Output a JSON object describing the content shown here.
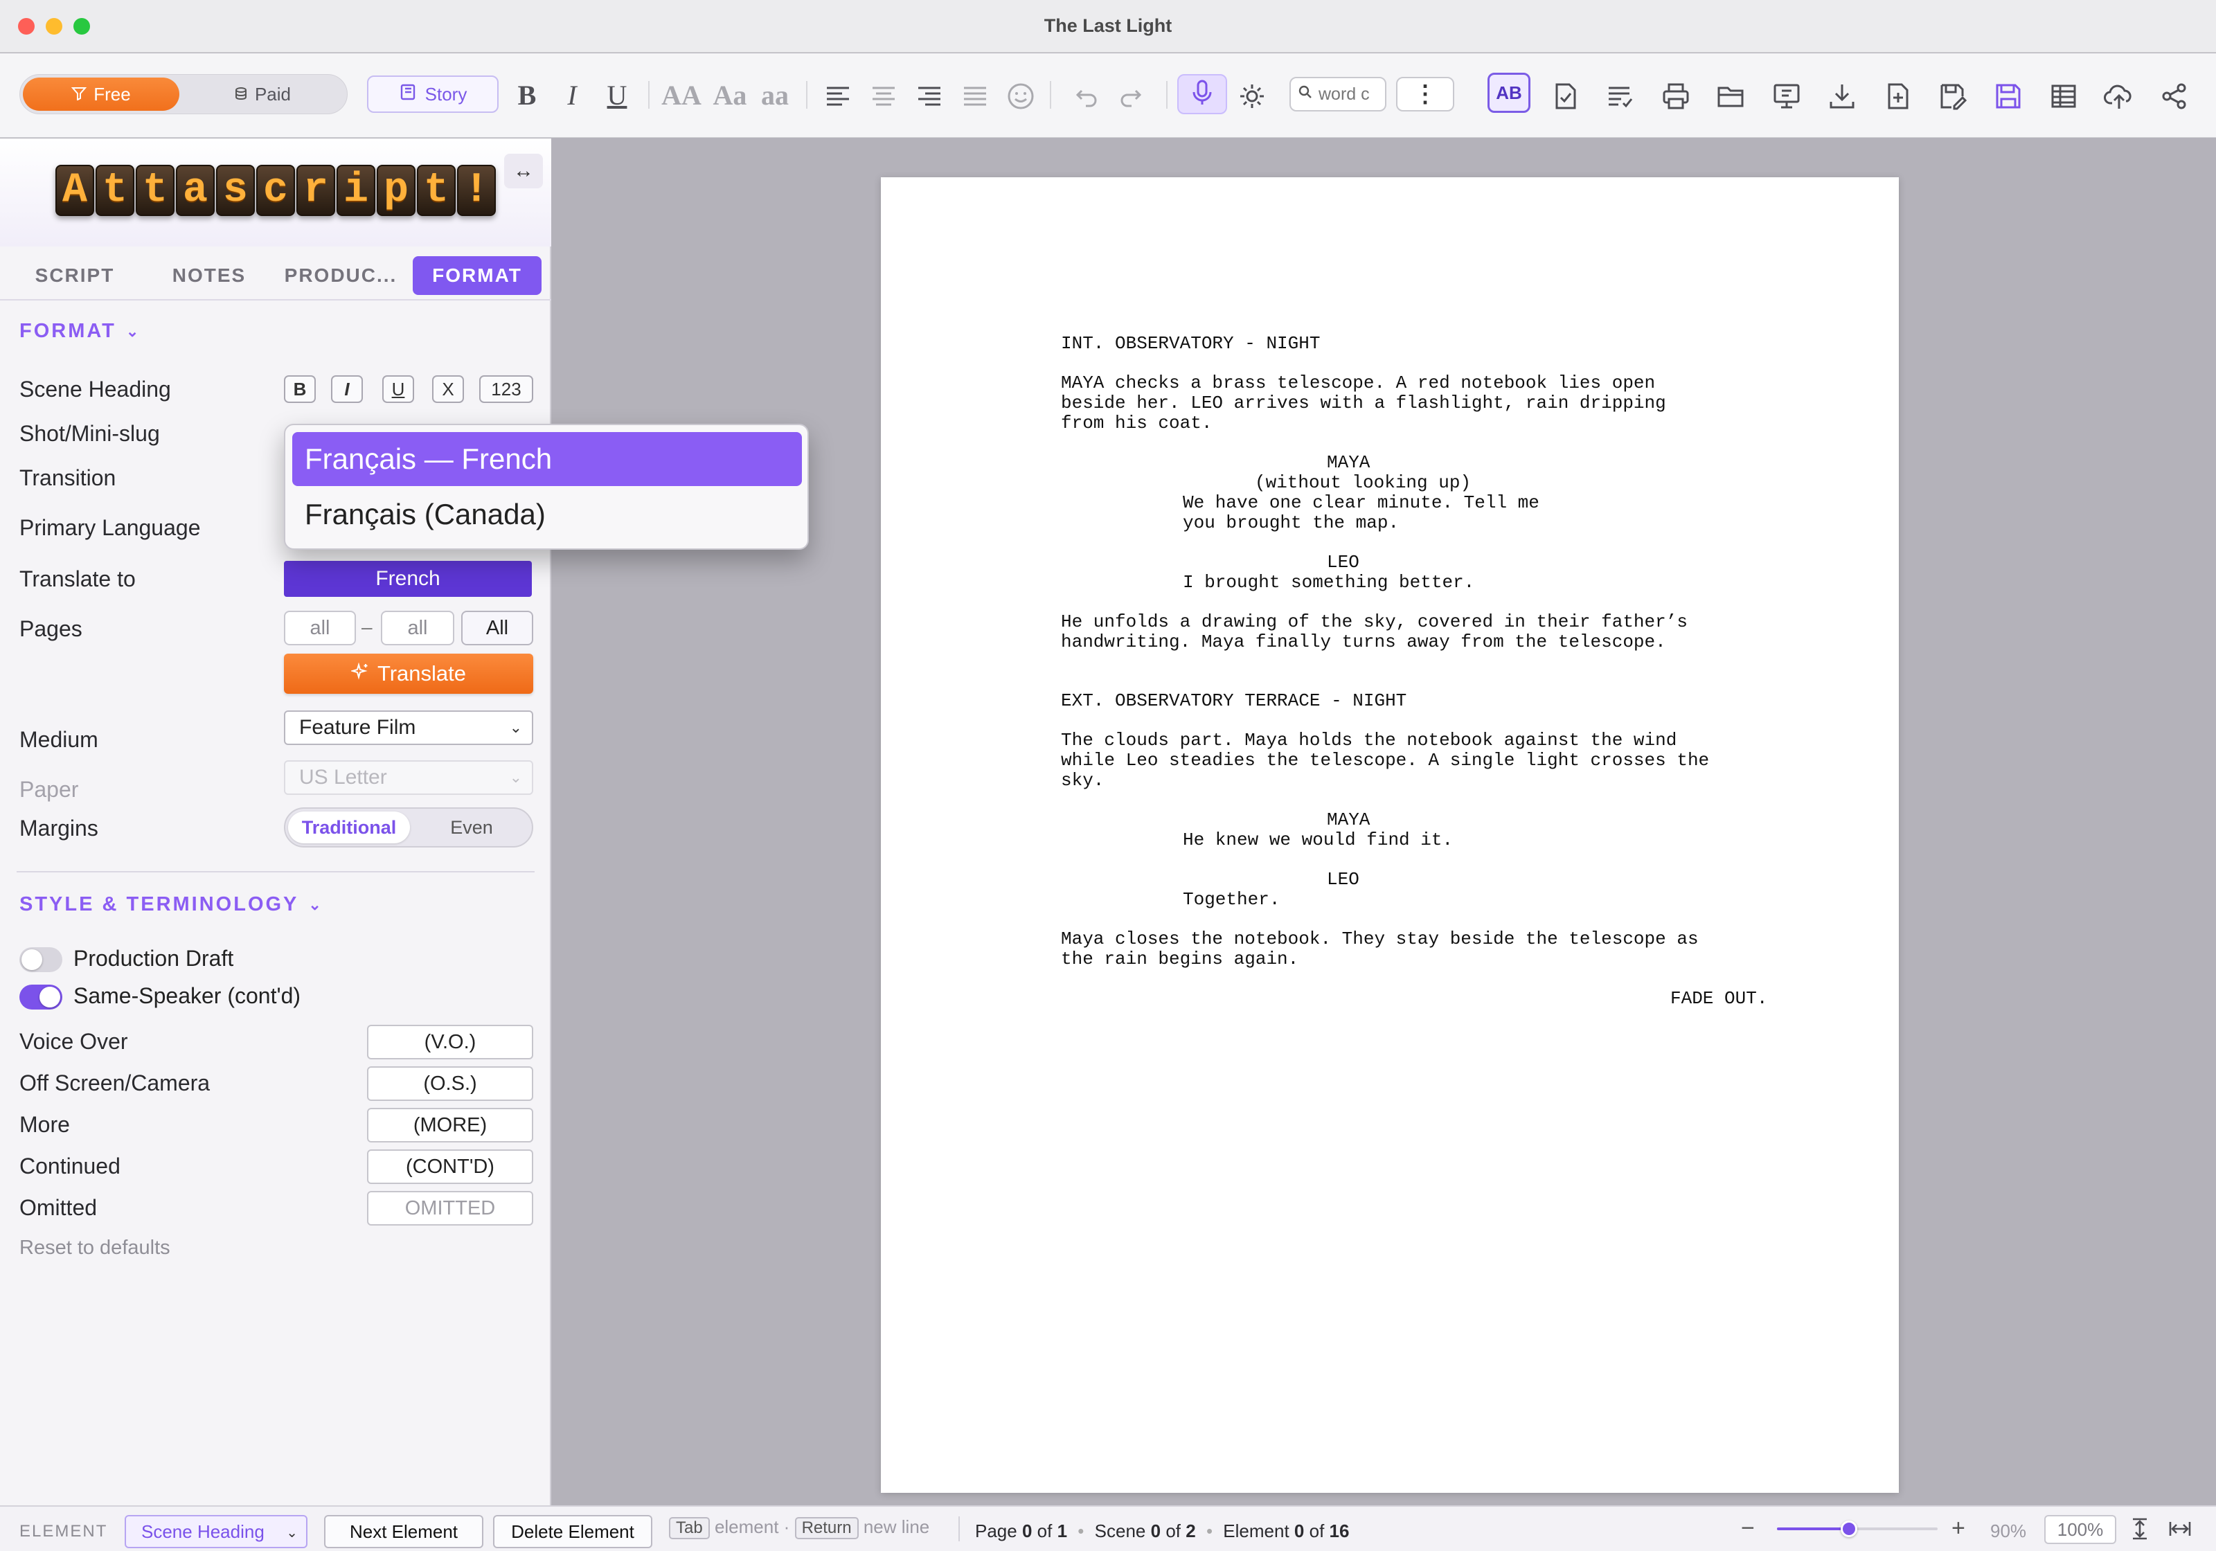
{
  "window": {
    "title": "The Last Light"
  },
  "toolbar": {
    "free_label": "Free",
    "paid_label": "Paid",
    "story_label": "Story",
    "bold_label": "B",
    "italic_label": "I",
    "underline_label": "U",
    "case_upper": "AA",
    "case_title": "Aa",
    "case_lower": "aa",
    "search_placeholder": "word c",
    "spellcheck_label": "AB",
    "accent_color": "#7b52ea",
    "free_color": "#f47a26"
  },
  "sidebar": {
    "logo_letters": [
      "A",
      "t",
      "t",
      "a",
      "s",
      "c",
      "r",
      "i",
      "p",
      "t",
      "!"
    ],
    "tabs": [
      {
        "label": "SCRIPT"
      },
      {
        "label": "NOTES"
      },
      {
        "label": "PRODUC..."
      },
      {
        "label": "FORMAT"
      }
    ],
    "format_section": {
      "title": "FORMAT",
      "scene_heading": "Scene Heading",
      "style_buttons": [
        "B",
        "I",
        "U",
        "X",
        "123"
      ],
      "shot": "Shot/Mini-slug",
      "transition": "Transition",
      "primary_language": "Primary Language",
      "translate_to": "Translate to",
      "translate_to_value": "French",
      "pages": "Pages",
      "pages_from": "all",
      "pages_dash": "–",
      "pages_to": "all",
      "pages_all_button": "All",
      "translate_button": "Translate",
      "medium": "Medium",
      "medium_value": "Feature Film",
      "paper": "Paper",
      "paper_value": "US Letter",
      "margins": "Margins",
      "margins_options": [
        "Traditional",
        "Even"
      ],
      "margins_selected": "Traditional"
    },
    "style_section": {
      "title": "STYLE & TERMINOLOGY",
      "production_draft": "Production Draft",
      "production_draft_on": false,
      "same_speaker": "Same-Speaker (cont'd)",
      "same_speaker_on": true,
      "terms": [
        {
          "label": "Voice Over",
          "value": "(V.O.)"
        },
        {
          "label": "Off Screen/Camera",
          "value": "(O.S.)"
        },
        {
          "label": "More",
          "value": "(MORE)"
        },
        {
          "label": "Continued",
          "value": "(CONT'D)"
        },
        {
          "label": "Omitted",
          "value": "OMITTED"
        }
      ],
      "reset_label": "Reset to defaults"
    }
  },
  "language_popup": {
    "options": [
      "Français — French",
      "Français (Canada)"
    ],
    "selected": "Français — French"
  },
  "script": {
    "lines": [
      {
        "type": "scene",
        "text": "INT. OBSERVATORY - NIGHT"
      },
      {
        "type": "action",
        "text": "MAYA checks a brass telescope. A red notebook lies open"
      },
      {
        "type": "action",
        "text": "beside her. LEO arrives with a flashlight, rain dripping"
      },
      {
        "type": "action",
        "text": "from his coat."
      },
      {
        "type": "character",
        "text": "MAYA"
      },
      {
        "type": "paren",
        "text": "(without looking up)"
      },
      {
        "type": "dialogue",
        "text": "We have one clear minute. Tell me"
      },
      {
        "type": "dialogue",
        "text": "you brought the map."
      },
      {
        "type": "character",
        "text": "LEO"
      },
      {
        "type": "dialogue",
        "text": "I brought something better."
      },
      {
        "type": "action",
        "text": "He unfolds a drawing of the sky, covered in their father’s"
      },
      {
        "type": "action",
        "text": "handwriting. Maya finally turns away from the telescope."
      },
      {
        "type": "scene",
        "text": "EXT. OBSERVATORY TERRACE - NIGHT"
      },
      {
        "type": "action",
        "text": "The clouds part. Maya holds the notebook against the wind"
      },
      {
        "type": "action",
        "text": "while Leo steadies the telescope. A single light crosses the"
      },
      {
        "type": "action",
        "text": "sky."
      },
      {
        "type": "character",
        "text": "MAYA"
      },
      {
        "type": "dialogue",
        "text": "He knew we would find it."
      },
      {
        "type": "character",
        "text": "LEO"
      },
      {
        "type": "dialogue",
        "text": "Together."
      },
      {
        "type": "action",
        "text": "Maya closes the notebook. They stay beside the telescope as"
      },
      {
        "type": "action",
        "text": "the rain begins again."
      },
      {
        "type": "transition",
        "text": "FADE OUT."
      }
    ]
  },
  "statusbar": {
    "element_label": "ELEMENT",
    "element_value": "Scene Heading",
    "next_button": "Next Element",
    "delete_button": "Delete Element",
    "tab_key": "Tab",
    "tab_hint": "element ·",
    "return_key": "Return",
    "return_hint": "new line",
    "page_label": "Page",
    "page_current": "0",
    "page_of": "of",
    "page_total": "1",
    "scene_label": "Scene",
    "scene_current": "0",
    "scene_of": "of",
    "scene_total": "2",
    "element_count_label": "Element",
    "element_current": "0",
    "element_of": "of",
    "element_total": "16",
    "zoom_minus": "−",
    "zoom_plus": "+",
    "zoom_level": "90%",
    "zoom_level_fraction": 0.45,
    "zoom_reset": "100%"
  }
}
